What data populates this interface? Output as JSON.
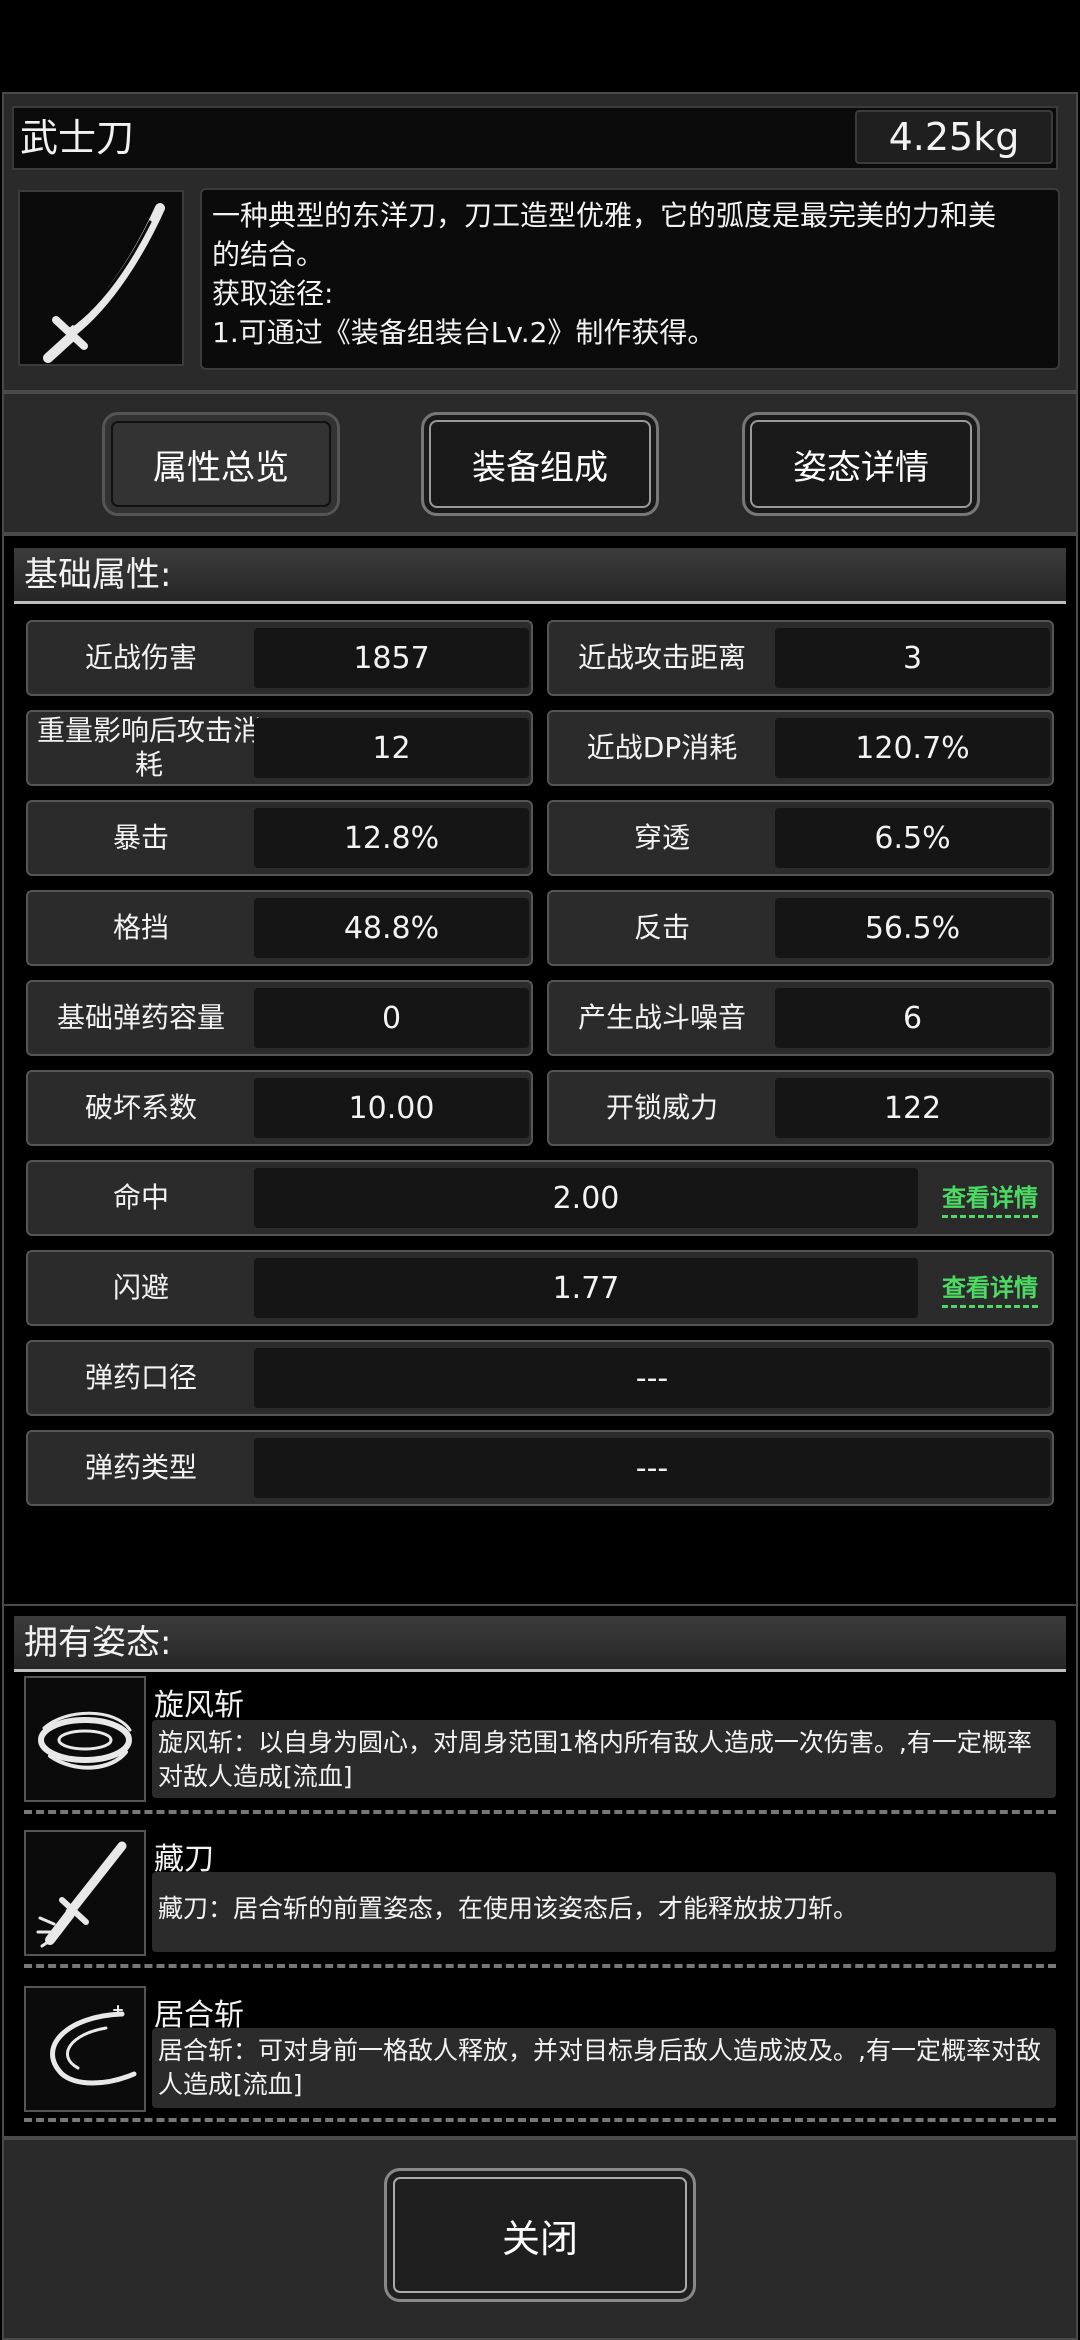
{
  "item": {
    "name": "武士刀",
    "weight": "4.25kg",
    "description_lines": [
      "一种典型的东洋刀，刀工造型优雅，它的弧度是最完美的力和美",
      "的结合。",
      "获取途径:",
      "1.可通过《装备组装台Lv.2》制作获得。"
    ]
  },
  "tabs": [
    {
      "label": "属性总览"
    },
    {
      "label": "装备组成"
    },
    {
      "label": "姿态详情"
    }
  ],
  "basic_attrs": {
    "title": "基础属性:",
    "pairs": [
      {
        "l_label": "近战伤害",
        "l_value": "1857",
        "r_label": "近战攻击距离",
        "r_value": "3"
      },
      {
        "l_label": "重量影响后攻击消耗",
        "l_value": "12",
        "r_label": "近战DP消耗",
        "r_value": "120.7%"
      },
      {
        "l_label": "暴击",
        "l_value": "12.8%",
        "r_label": "穿透",
        "r_value": "6.5%"
      },
      {
        "l_label": "格挡",
        "l_value": "48.8%",
        "r_label": "反击",
        "r_value": "56.5%"
      },
      {
        "l_label": "基础弹药容量",
        "l_value": "0",
        "r_label": "产生战斗噪音",
        "r_value": "6"
      },
      {
        "l_label": "破坏系数",
        "l_value": "10.00",
        "r_label": "开锁威力",
        "r_value": "122"
      }
    ],
    "wide": [
      {
        "label": "命中",
        "value": "2.00",
        "link": "查看详情"
      },
      {
        "label": "闪避",
        "value": "1.77",
        "link": "查看详情"
      },
      {
        "label": "弹药口径",
        "value": "---"
      },
      {
        "label": "弹药类型",
        "value": "---"
      }
    ]
  },
  "poses": {
    "title": "拥有姿态:",
    "items": [
      {
        "name": "旋风斩",
        "desc": "旋风斩：以自身为圆心，对周身范围1格内所有敌人造成一次伤害。,有一定概率对敌人造成[流血]"
      },
      {
        "name": "藏刀",
        "desc": "藏刀：居合斩的前置姿态，在使用该姿态后，才能释放拔刀斩。"
      },
      {
        "name": "居合斩",
        "desc": "居合斩：可对身前一格敌人释放，并对目标身后敌人造成波及。,有一定概率对敌人造成[流血]"
      }
    ]
  },
  "footer": {
    "close_label": "关闭"
  }
}
